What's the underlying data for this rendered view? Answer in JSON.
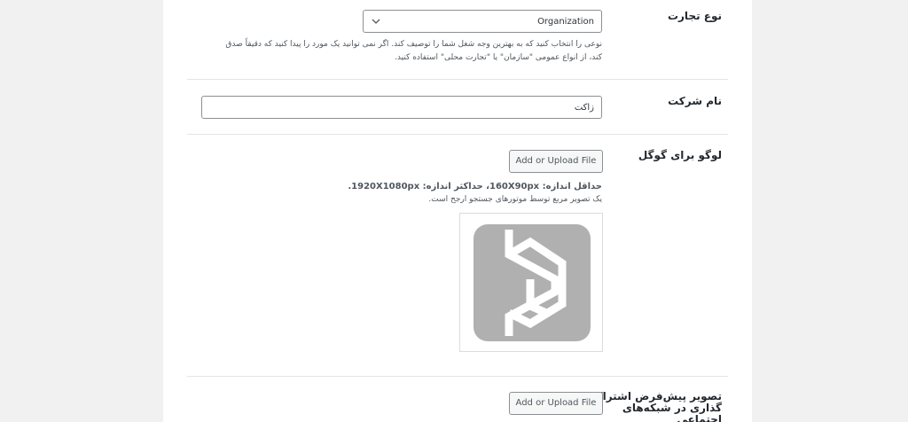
{
  "business_type": {
    "label": "نوع تجارت",
    "selected": "Organization",
    "description_line1": "نوعی را انتخاب کنید که به بهترین وجه شغل شما را توصیف کند. اگر نمی توانید یک مورد را پیدا کنید که دقیقاً صدق",
    "description_line2": "کند، از انواع عمومی \"سازمان\" یا \"تجارت محلی\" استفاده کنید."
  },
  "company_name": {
    "label": "نام شرکت",
    "value": "زاکت"
  },
  "google_logo": {
    "label": "لوگو برای گوگل",
    "button": "Add or Upload File",
    "size_note": "حداقل اندازه: 160X90px، حداکثر اندازه: 1920X1080px.",
    "size_sub": "یک تصویر مربع توسط موتورهای جستجو ارجح است.",
    "preview_icon": "zakat-logo-icon"
  },
  "social_image": {
    "label_line1": "تصویر پیش‌فرض اشتراک",
    "label_line2": "گذاری در شبکه‌های",
    "label_line3": "اجتماعی",
    "button": "Add or Upload File"
  },
  "colors": {
    "logo_gray": "#b0b0b0",
    "border": "#8c8f94",
    "divider": "#e5e5e5"
  }
}
